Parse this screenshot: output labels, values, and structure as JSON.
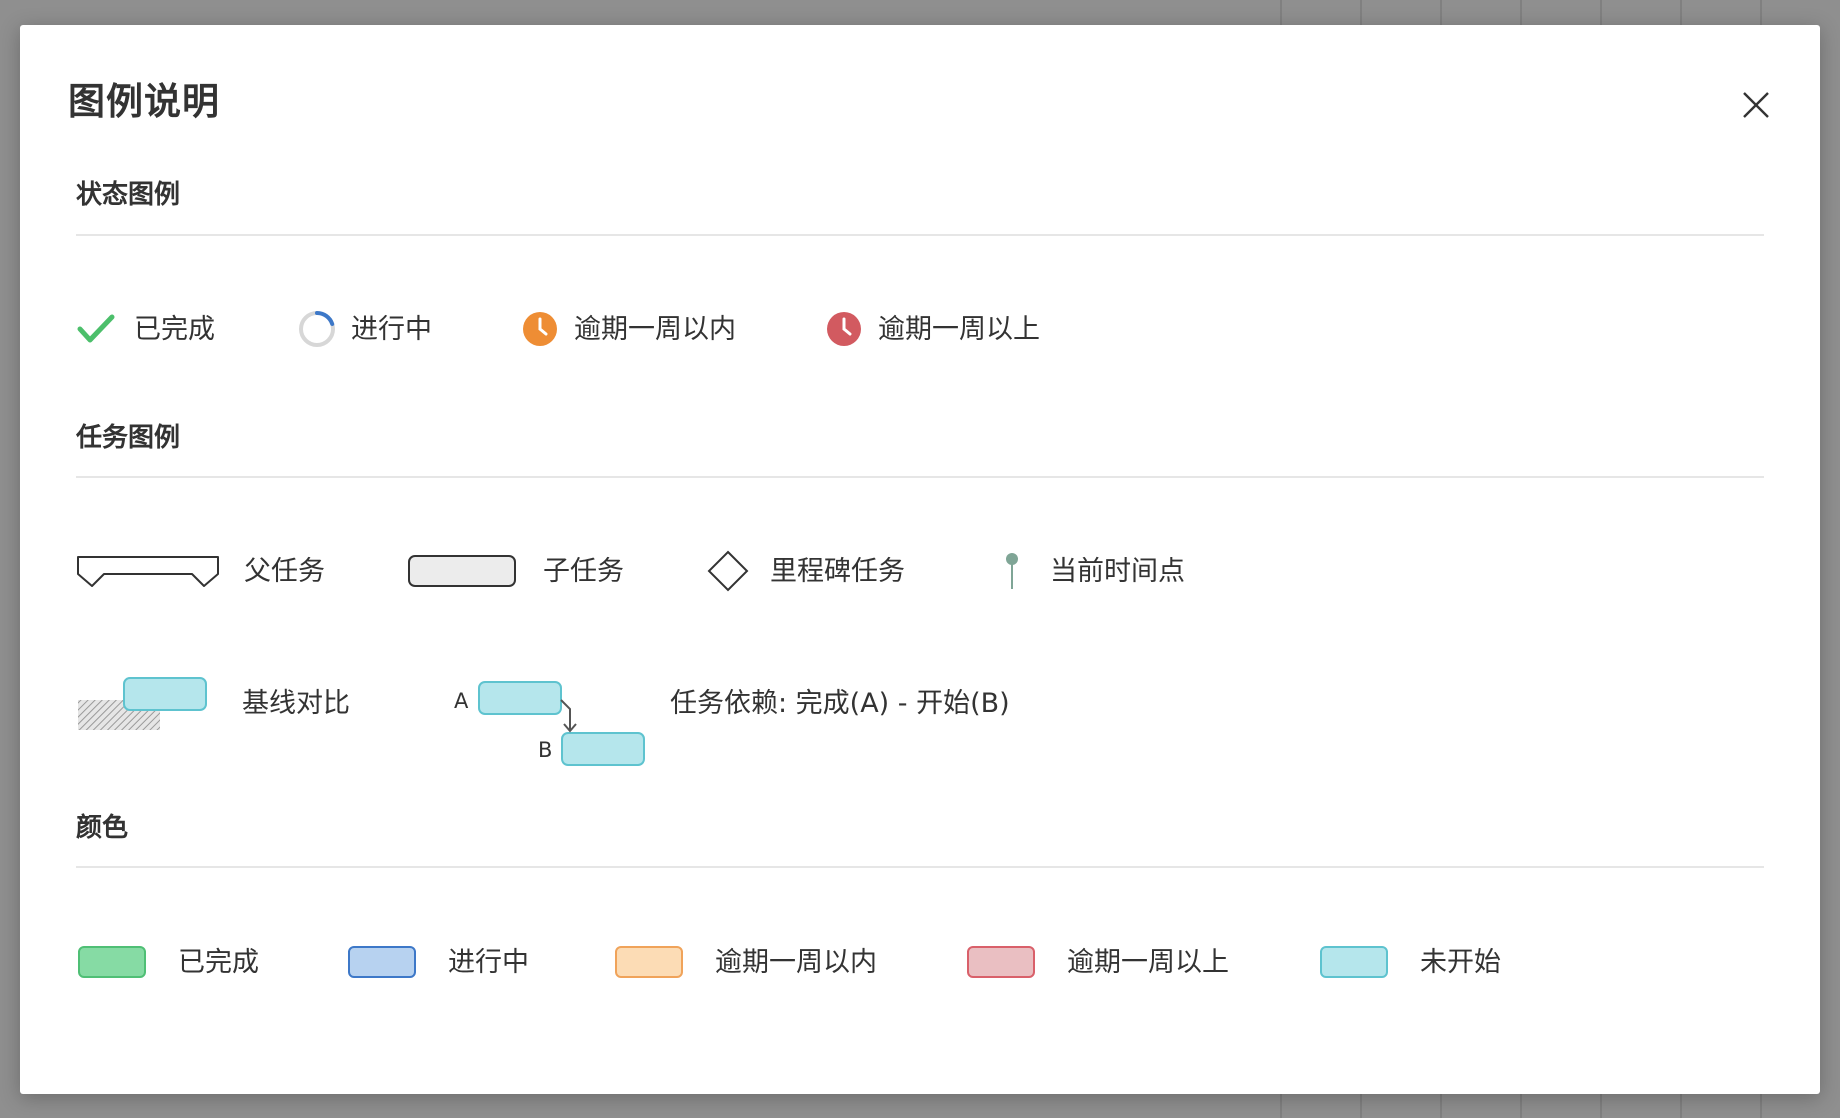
{
  "modal": {
    "title": "图例说明"
  },
  "sections": {
    "status": {
      "title": "状态图例",
      "items": [
        {
          "label": "已完成",
          "icon": "check-icon"
        },
        {
          "label": "进行中",
          "icon": "progress-ring-icon"
        },
        {
          "label": "逾期一周以内",
          "icon": "clock-orange-icon"
        },
        {
          "label": "逾期一周以上",
          "icon": "clock-red-icon"
        }
      ]
    },
    "tasks": {
      "title": "任务图例",
      "items": [
        {
          "label": "父任务",
          "icon": "parent-task-shape"
        },
        {
          "label": "子任务",
          "icon": "subtask-shape"
        },
        {
          "label": "里程碑任务",
          "icon": "milestone-diamond-icon"
        },
        {
          "label": "当前时间点",
          "icon": "current-time-pin-icon"
        },
        {
          "label": "基线对比",
          "icon": "baseline-compare-shape"
        },
        {
          "label": "任务依赖: 完成(A) - 开始(B)",
          "icon": "dependency-shape"
        }
      ],
      "dependency_labels": {
        "a": "A",
        "b": "B"
      }
    },
    "colors": {
      "title": "颜色",
      "items": [
        {
          "label": "已完成",
          "fill": "#86dba4",
          "border": "#4fbf75"
        },
        {
          "label": "进行中",
          "fill": "#b7d2f0",
          "border": "#3d78c8"
        },
        {
          "label": "逾期一周以内",
          "fill": "#fcdcb5",
          "border": "#f0a35a"
        },
        {
          "label": "逾期一周以上",
          "fill": "#eabfc2",
          "border": "#d9606a"
        },
        {
          "label": "未开始",
          "fill": "#b5e6ec",
          "border": "#5ec3cf"
        }
      ]
    }
  },
  "colors": {
    "check": "#4cbf6b",
    "progress": "#3d78c8",
    "overdue_within_week": "#ee8d34",
    "overdue_over_week": "#d25a60",
    "not_started_fill": "#b5e6ec",
    "not_started_border": "#5ec3cf"
  }
}
